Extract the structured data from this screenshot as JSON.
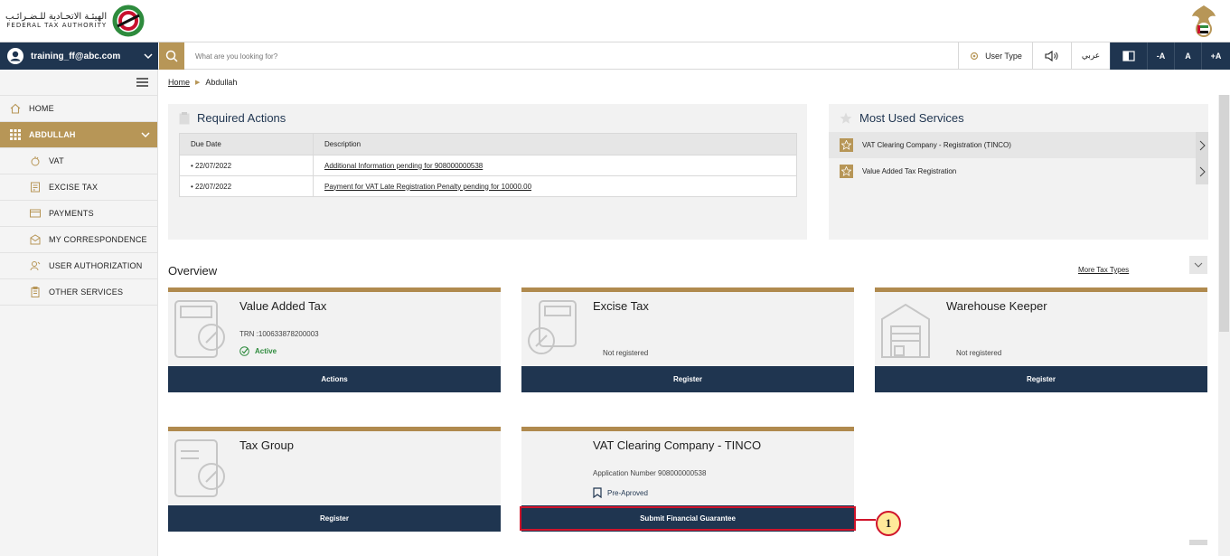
{
  "header": {
    "logo_arabic": "الهيئـة الاتحـادية للـضـرائـب",
    "logo_english": "FEDERAL TAX AUTHORITY"
  },
  "navbar": {
    "user_email": "training_ff@abc.com",
    "search_placeholder": "What are you looking for?",
    "user_type_label": "User Type",
    "arabic_label": "عربي",
    "font_decrease": "-A",
    "font_normal": "A",
    "font_increase": "+A"
  },
  "sidebar": {
    "items": [
      {
        "label": "HOME",
        "icon": "home-icon"
      },
      {
        "label": "ABDULLAH",
        "icon": "grid-icon",
        "active": true
      },
      {
        "label": "VAT",
        "icon": "vat-icon"
      },
      {
        "label": "EXCISE TAX",
        "icon": "excise-icon"
      },
      {
        "label": "PAYMENTS",
        "icon": "payments-icon"
      },
      {
        "label": "MY CORRESPONDENCE",
        "icon": "correspondence-icon"
      },
      {
        "label": "USER AUTHORIZATION",
        "icon": "user-authorization-icon"
      },
      {
        "label": "OTHER SERVICES",
        "icon": "other-services-icon"
      }
    ]
  },
  "breadcrumb": {
    "home": "Home",
    "current": "Abdullah"
  },
  "required_actions": {
    "title": "Required Actions",
    "columns": [
      "Due Date",
      "Description"
    ],
    "rows": [
      {
        "date": "• 22/07/2022",
        "description": "Additional Information pending for 908000000538"
      },
      {
        "date": "• 22/07/2022",
        "description": "Payment for VAT Late Registration Penalty pending for 10000.00"
      }
    ]
  },
  "most_used_services": {
    "title": "Most Used Services",
    "items": [
      "VAT Clearing Company - Registration (TINCO)",
      "Value Added Tax Registration"
    ]
  },
  "overview": {
    "title": "Overview",
    "more_link": "More Tax Types",
    "cards": [
      {
        "title": "Value Added Tax",
        "line1": "TRN :100633878200003",
        "status": "Active",
        "button": "Actions"
      },
      {
        "title": "Excise Tax",
        "status": "Not registered",
        "button": "Register"
      },
      {
        "title": "Warehouse Keeper",
        "status": "Not registered",
        "button": "Register"
      },
      {
        "title": "Tax Group",
        "button": "Register"
      },
      {
        "title": "VAT Clearing Company - TINCO",
        "line1": "Application Number 908000000538",
        "status": "Pre-Aproved",
        "button": "Submit Financial Guarantee"
      }
    ]
  },
  "callout": {
    "number": "1"
  },
  "colors": {
    "navy": "#1f3550",
    "gold": "#b79657",
    "highlight_red": "#d0142b"
  }
}
